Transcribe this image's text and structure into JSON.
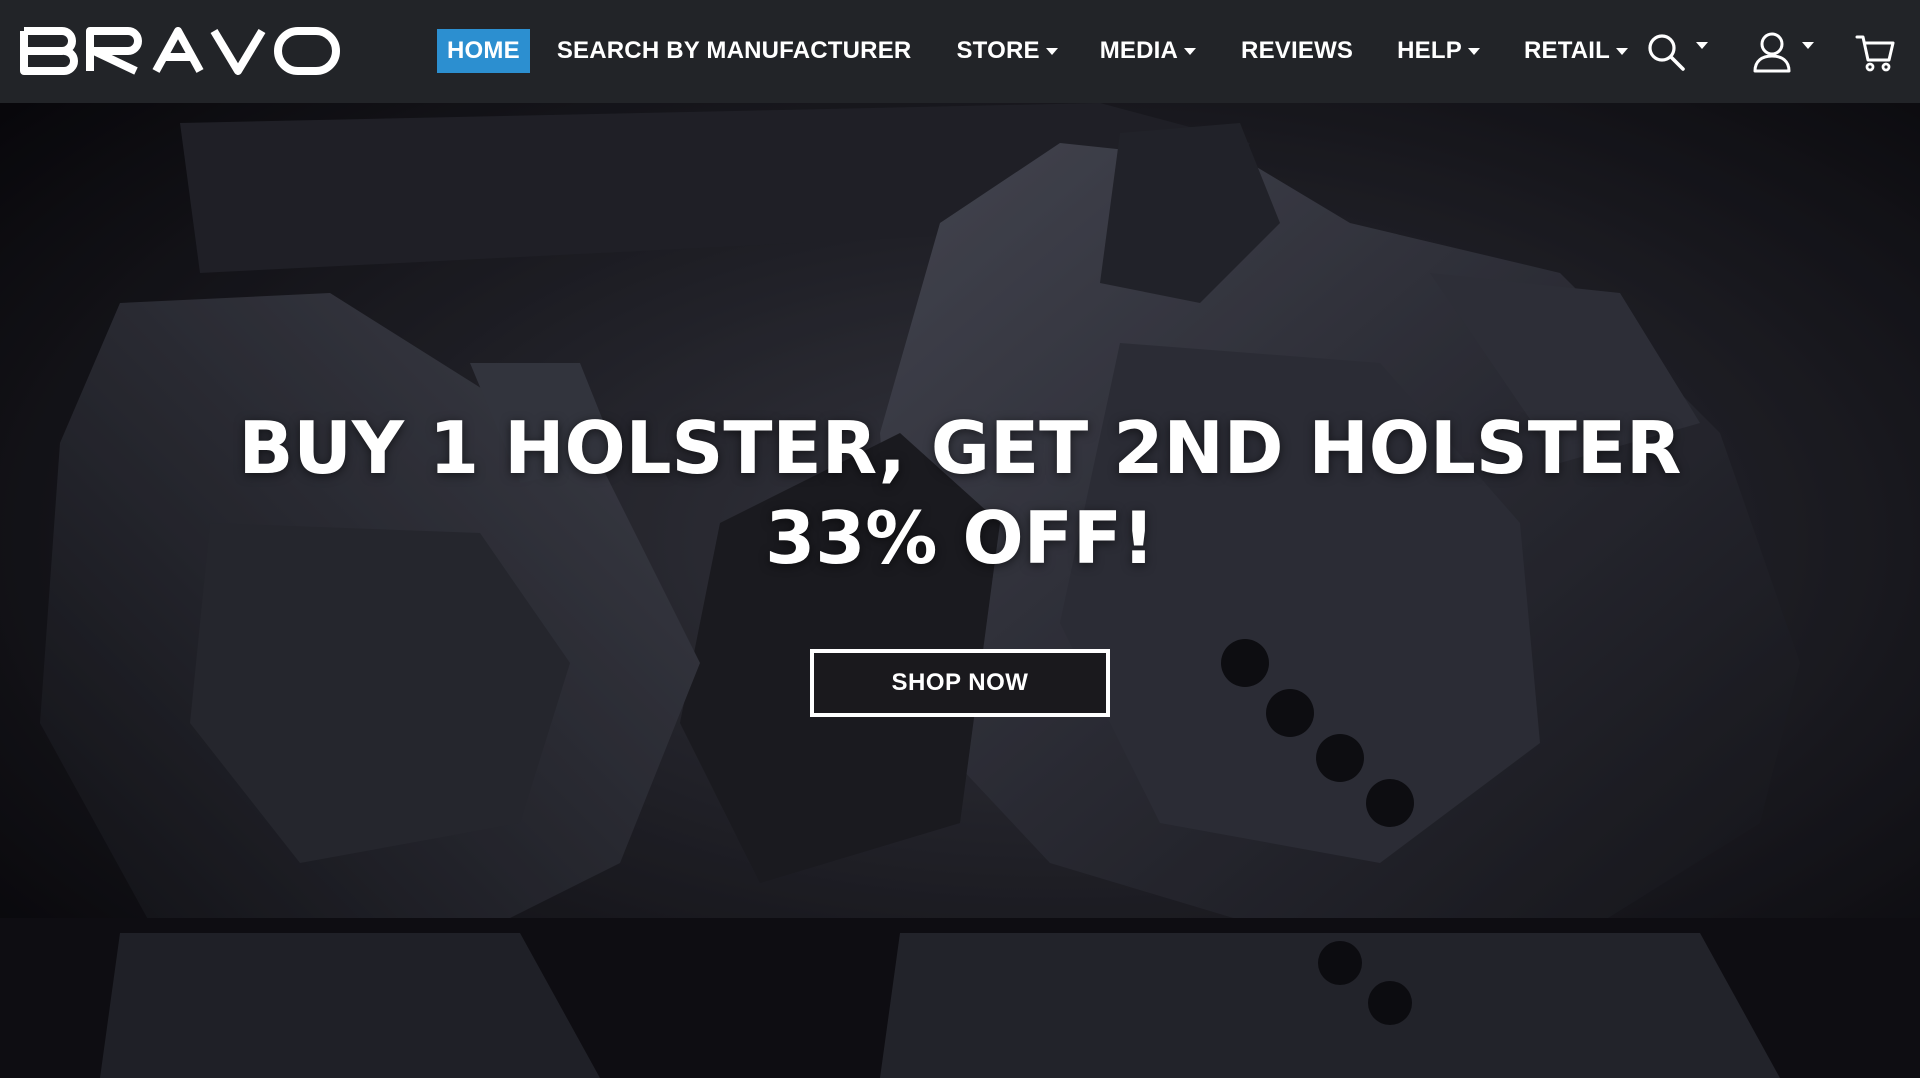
{
  "brand": {
    "name": "BRAVO"
  },
  "nav": {
    "items": [
      {
        "label": "HOME",
        "active": true,
        "dropdown": false
      },
      {
        "label": "SEARCH BY MANUFACTURER",
        "active": false,
        "dropdown": false
      },
      {
        "label": "STORE",
        "active": false,
        "dropdown": true
      },
      {
        "label": "MEDIA",
        "active": false,
        "dropdown": true
      },
      {
        "label": "REVIEWS",
        "active": false,
        "dropdown": false
      },
      {
        "label": "HELP",
        "active": false,
        "dropdown": true
      },
      {
        "label": "RETAIL",
        "active": false,
        "dropdown": true
      }
    ],
    "icons": [
      "search-icon",
      "account-icon",
      "cart-icon"
    ]
  },
  "hero": {
    "headline": "BUY 1 HOLSTER, GET 2ND HOLSTER 33% OFF!",
    "cta_label": "SHOP NOW"
  },
  "colors": {
    "nav_bg": "#222428",
    "active_tab": "#2c8fd0",
    "text": "#ffffff",
    "hero_dark": "#141318"
  }
}
